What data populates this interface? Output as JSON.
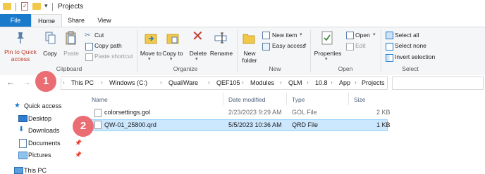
{
  "window": {
    "title": "Projects"
  },
  "tabs": {
    "file": "File",
    "home": "Home",
    "share": "Share",
    "view": "View"
  },
  "ribbon": {
    "clipboard": {
      "pin_label": "Pin to Quick access",
      "copy_label": "Copy",
      "paste_label": "Paste",
      "cut_label": "Cut",
      "copy_path_label": "Copy path",
      "paste_shortcut_label": "Paste shortcut",
      "group_label": "Clipboard"
    },
    "organize": {
      "move_to_label": "Move to",
      "copy_to_label": "Copy to",
      "delete_label": "Delete",
      "rename_label": "Rename",
      "group_label": "Organize"
    },
    "new": {
      "new_folder_label": "New folder",
      "new_item_label": "New item",
      "easy_access_label": "Easy access",
      "group_label": "New"
    },
    "open": {
      "properties_label": "Properties",
      "open_label": "Open",
      "edit_label": "Edit",
      "group_label": "Open"
    },
    "select": {
      "select_all_label": "Select all",
      "select_none_label": "Select none",
      "invert_selection_label": "Invert selection",
      "group_label": "Select"
    }
  },
  "address": {
    "breadcrumbs": [
      "This PC",
      "Windows (C:)",
      "QualiWare",
      "QEF105",
      "Modules",
      "QLM",
      "10.8",
      "App",
      "Projects"
    ]
  },
  "nav_pane": {
    "items": [
      "Quick access",
      "Desktop",
      "Downloads",
      "Documents",
      "Pictures",
      "This PC"
    ]
  },
  "file_list": {
    "columns": [
      "Name",
      "Date modified",
      "Type",
      "Size"
    ],
    "rows": [
      {
        "name": "colorsettings.gol",
        "date": "2/23/2023 9:29 AM",
        "type": "GOL File",
        "size": "2 KB"
      },
      {
        "name": "QW-01_25800.qrd",
        "date": "5/5/2023 10:36 AM",
        "type": "QRD File",
        "size": "1 KB"
      }
    ]
  },
  "annotations": {
    "marker1": "1",
    "marker2": "2"
  },
  "colors": {
    "accent": "#1979ca",
    "selection": "#cce8ff",
    "badge": "#e96d73"
  }
}
